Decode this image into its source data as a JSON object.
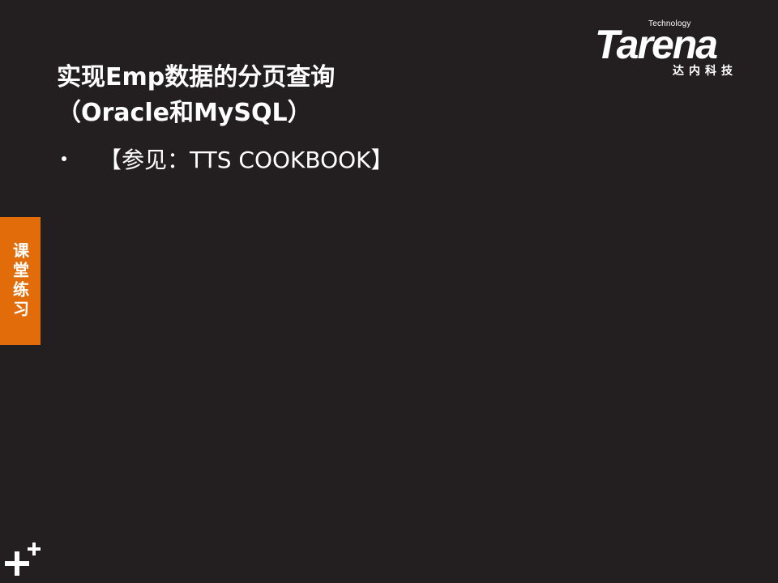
{
  "logo": {
    "technology": "Technology",
    "wordmark": "Tarena",
    "chinese": "达内科技"
  },
  "slide": {
    "title_line1": "实现Emp数据的分页查询",
    "title_line2": "（Oracle和MySQL）",
    "bullets": [
      {
        "text": "【参见：TTS COOKBOOK】"
      }
    ]
  },
  "side_tab": {
    "label": "课堂练习",
    "color": "#e36c0a"
  },
  "decoration": {
    "icon": "plus-icon"
  },
  "colors": {
    "background": "#231f20",
    "text": "#ffffff",
    "accent": "#e36c0a"
  }
}
